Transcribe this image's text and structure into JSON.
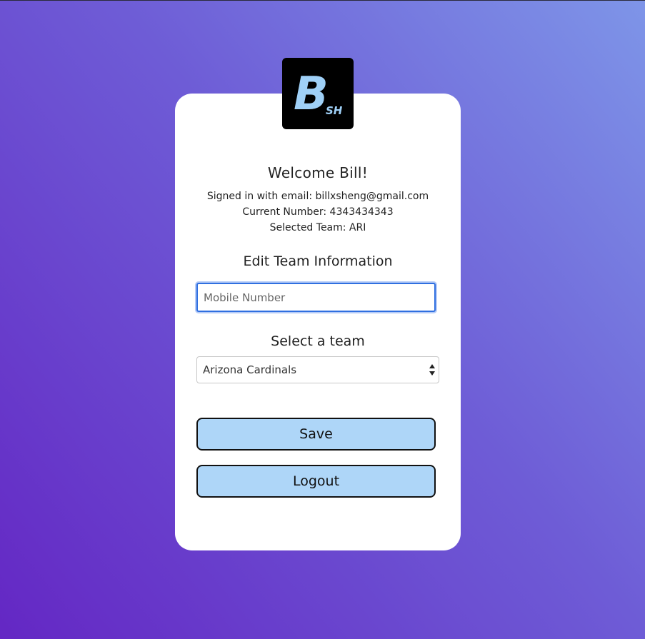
{
  "logo": {
    "letter": "B",
    "suffix": "SH",
    "background": "#000000",
    "accent": "#9fd0f7"
  },
  "profile": {
    "welcome": "Welcome Bill!",
    "email_line": "Signed in with email: billxsheng@gmail.com",
    "number_line": "Current Number: 4343434343",
    "team_line": "Selected Team: ARI"
  },
  "edit": {
    "title": "Edit Team Information",
    "mobile_placeholder": "Mobile Number",
    "mobile_value": ""
  },
  "team": {
    "title": "Select a team",
    "selected": "Arizona Cardinals"
  },
  "actions": {
    "save_label": "Save",
    "logout_label": "Logout"
  },
  "colors": {
    "button_bg": "#aed6f8",
    "focus_ring": "#2f6fe0",
    "gradient_start": "#6427c4",
    "gradient_end": "#7e95e8"
  }
}
